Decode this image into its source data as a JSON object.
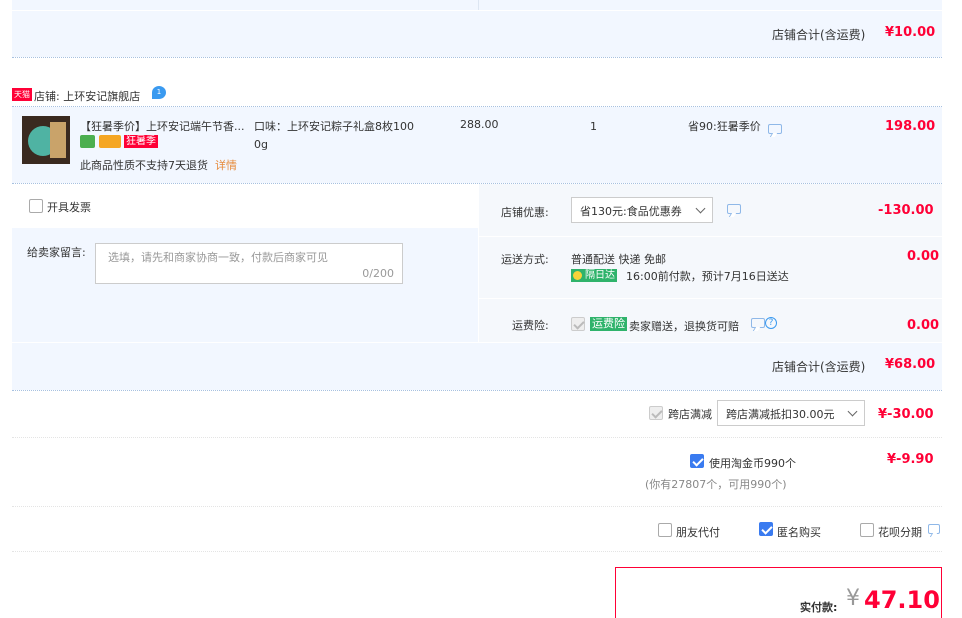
{
  "top_total": {
    "label": "店铺合计(含运费)",
    "value": "¥10.00"
  },
  "store": {
    "tag": "天猫",
    "label": "店铺: 上环安记旗舰店"
  },
  "item": {
    "title": "【狂暑季价】上环安记端午节香...",
    "promo_tag": "狂暑季",
    "return_note": "此商品性质不支持7天退货",
    "detail_link": "详情",
    "spec": "口味：上环安记粽子礼盒8枚100 0g",
    "price": "288.00",
    "qty": "1",
    "discount": "省90:狂暑季价",
    "subtotal": "198.00"
  },
  "invoice": {
    "label": "开具发票"
  },
  "message": {
    "label": "给卖家留言:",
    "placeholder": "选填，请先和商家协商一致，付款后商家可见",
    "counter": "0/200"
  },
  "coupon": {
    "label": "店铺优惠:",
    "selected": "省130元:食品优惠券",
    "value": "-130.00"
  },
  "shipping": {
    "label": "运送方式:",
    "method": "普通配送 快递 免邮",
    "badge": "隔日达",
    "note": "16:00前付款，预计7月16日送达",
    "value": "0.00"
  },
  "insurance": {
    "label": "运费险:",
    "badge": "运费险",
    "note": "卖家赠送，退换货可赔",
    "value": "0.00"
  },
  "store_total": {
    "label": "店铺合计(含运费)",
    "value": "¥68.00"
  },
  "cross_store": {
    "label": "跨店满减",
    "selected": "跨店满减抵扣30.00元",
    "value": "¥-30.00"
  },
  "coins": {
    "label": "使用淘金币990个",
    "note": "(你有27807个，可用990个)",
    "value": "¥-9.90"
  },
  "options": {
    "friend_pay": "朋友代付",
    "anonymous": "匿名购买",
    "huabei": "花呗分期"
  },
  "payment": {
    "label": "实付款:",
    "currency": "¥",
    "amount": "47.10"
  },
  "colors": {
    "accent_red": "#ff0036",
    "panel_bg": "#f2f7ff",
    "checkbox_blue": "#3a7bf0"
  }
}
